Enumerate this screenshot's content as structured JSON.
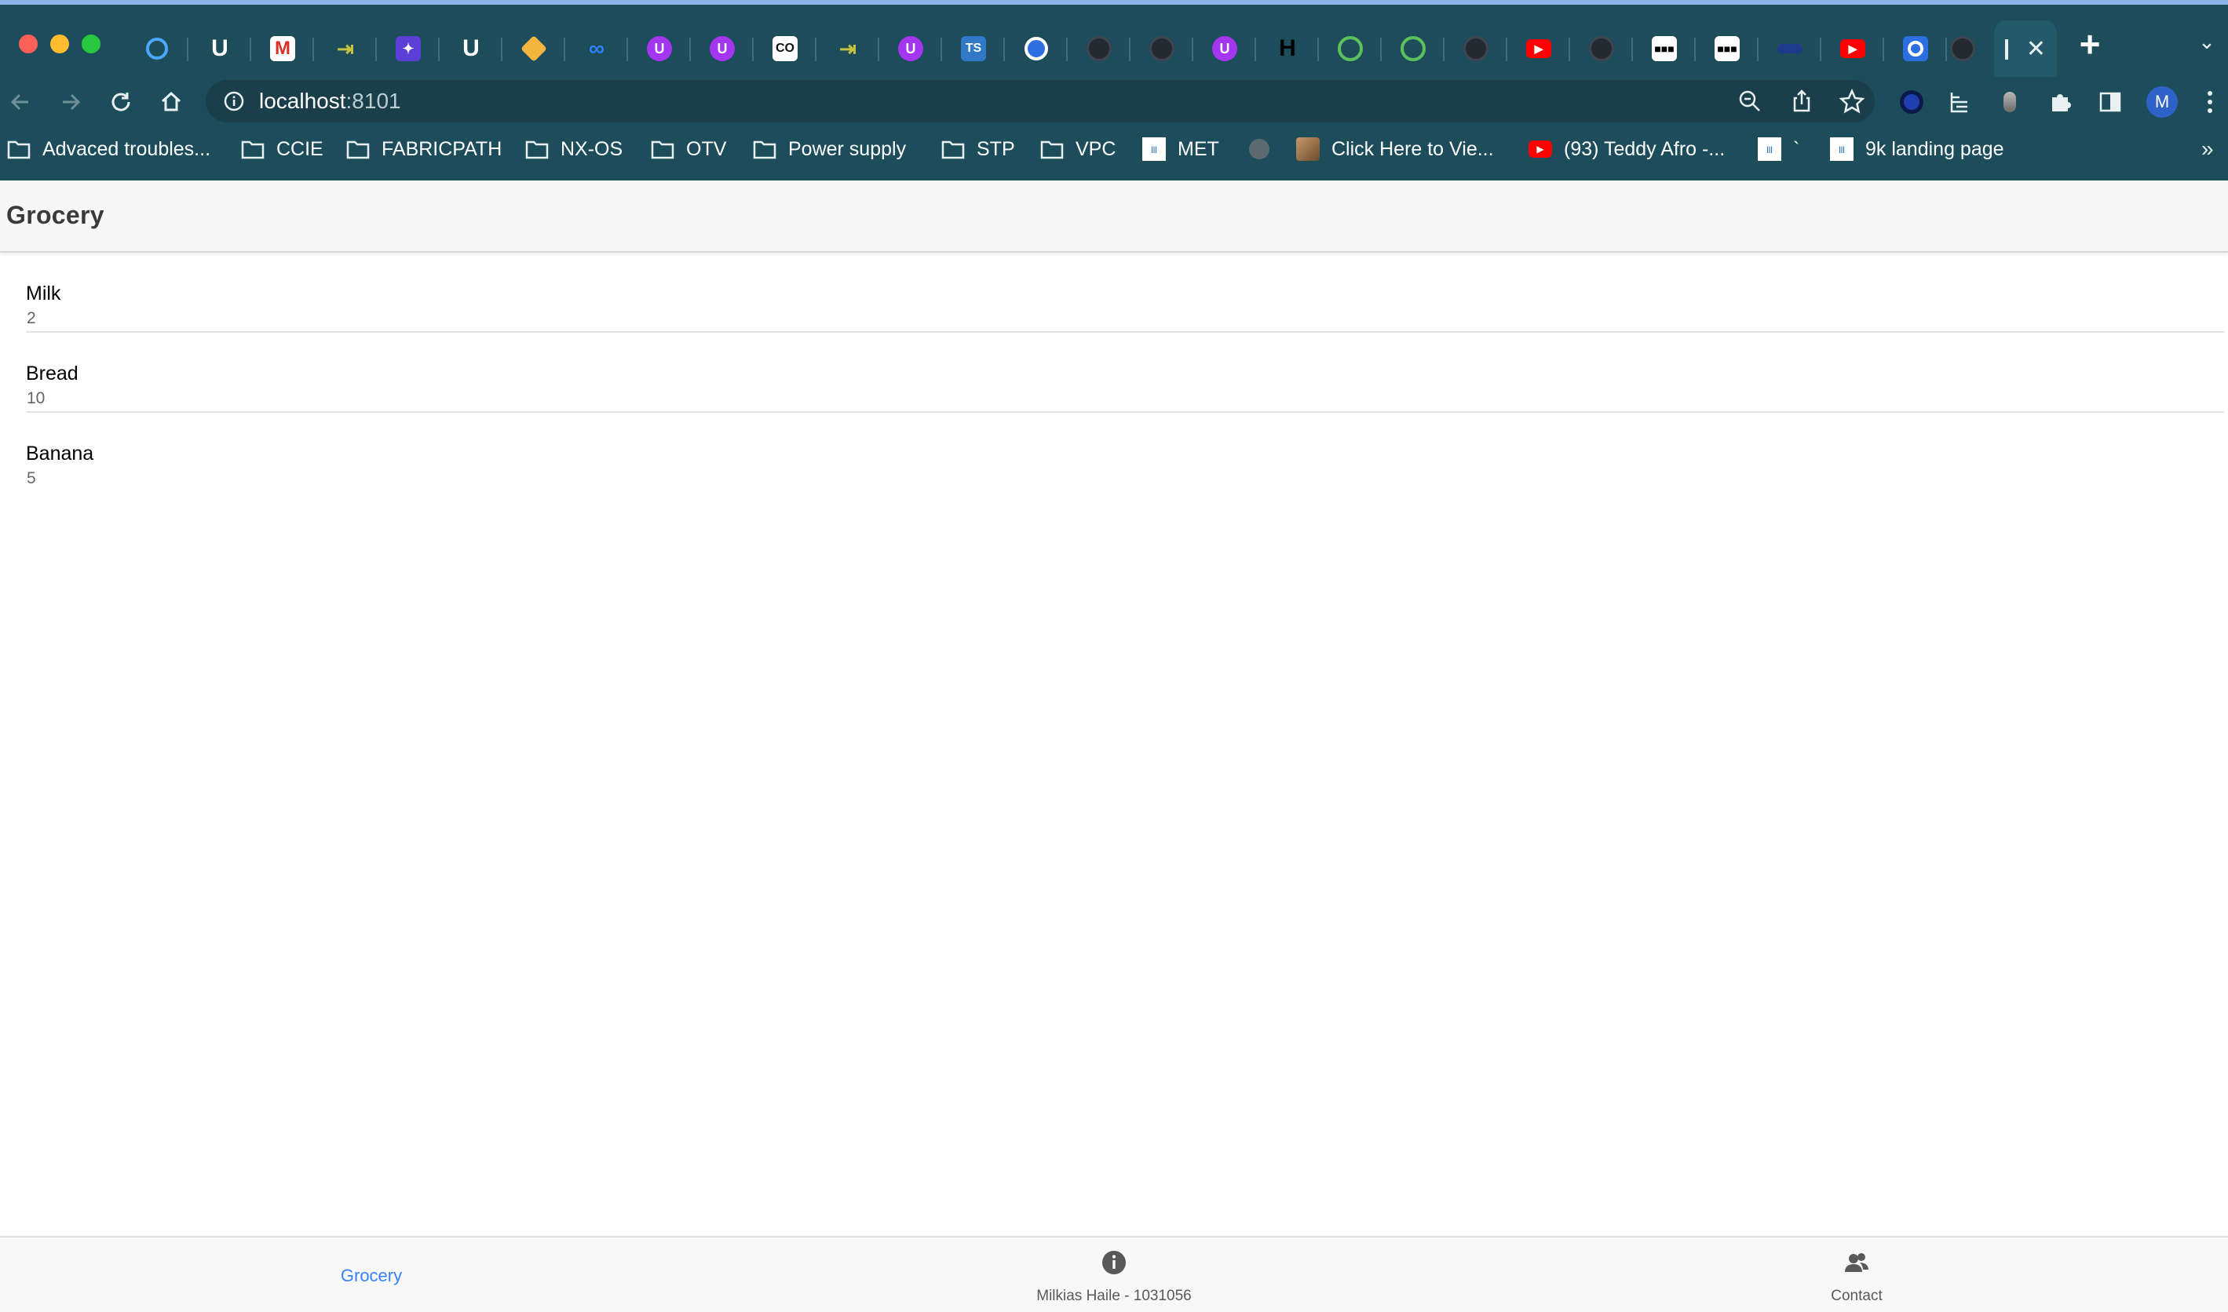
{
  "browser": {
    "url_host": "localhost",
    "url_port": ":8101",
    "profile_initial": "M",
    "bookmarks": [
      {
        "label": "Advaced troubles...",
        "icon": "folder-icon"
      },
      {
        "label": "CCIE",
        "icon": "folder-icon"
      },
      {
        "label": "FABRICPATH",
        "icon": "folder-icon"
      },
      {
        "label": "NX-OS",
        "icon": "folder-icon"
      },
      {
        "label": "OTV",
        "icon": "folder-icon"
      },
      {
        "label": "Power supply",
        "icon": "folder-icon"
      },
      {
        "label": "STP",
        "icon": "folder-icon"
      },
      {
        "label": "VPC",
        "icon": "folder-icon"
      },
      {
        "label": "MET",
        "icon": "cisco-icon"
      },
      {
        "label": "",
        "icon": "globe-icon"
      },
      {
        "label": "Click Here to Vie...",
        "icon": "photo-icon"
      },
      {
        "label": "(93) Teddy Afro -...",
        "icon": "youtube-icon"
      },
      {
        "label": "`",
        "icon": "cisco-icon"
      },
      {
        "label": "9k landing page",
        "icon": "cisco-icon"
      }
    ],
    "tab_favicons": [
      "search-icon",
      "magnet-icon",
      "gmail-icon",
      "arrow-icon",
      "ai-icon",
      "magnet-icon",
      "hexagon-icon",
      "meta-icon",
      "udemy-icon",
      "udemy-icon",
      "coursera-icon",
      "arrow-icon",
      "udemy-icon",
      "typescript-icon",
      "target-icon",
      "github-icon",
      "github-icon",
      "udemy-icon",
      "hashicorp-icon",
      "github-icon",
      "github-icon",
      "github-icon",
      "youtube-icon",
      "github-icon",
      "blackbox-icon",
      "blackbox-icon",
      "blank-icon",
      "youtube-icon",
      "target-icon",
      "github-icon"
    ]
  },
  "app": {
    "title": "Grocery",
    "items": [
      {
        "name": "Milk",
        "quantity": "2"
      },
      {
        "name": "Bread",
        "quantity": "10"
      },
      {
        "name": "Banana",
        "quantity": "5"
      }
    ]
  },
  "tabbar": {
    "grocery_label": "Grocery",
    "info_label": "Milkias Haile - 1031056",
    "contact_label": "Contact"
  },
  "colors": {
    "chrome_bg": "#1d4d5a",
    "accent": "#3880ff",
    "header_bg": "#f7f7f7"
  }
}
